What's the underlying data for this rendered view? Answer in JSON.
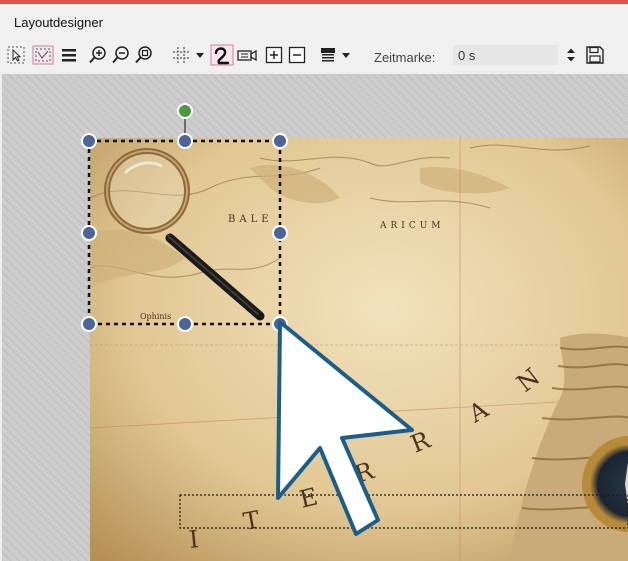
{
  "window": {
    "title": "Layoutdesigner"
  },
  "toolbar": {
    "icons": [
      "select-arrow-icon",
      "select-region-icon",
      "layers-icon",
      "zoom-in-icon",
      "zoom-out-icon",
      "zoom-fit-icon",
      "grid-icon",
      "dropdown-arrow-icon",
      "curve-path-icon",
      "camera-icon",
      "add-keyframe-icon",
      "remove-keyframe-icon",
      "text-style-icon",
      "dropdown-arrow-icon",
      "spinner-icon",
      "save-icon"
    ],
    "timestamp_label": "Zeitmarke:",
    "timestamp_value": "0 s"
  },
  "canvas": {
    "image_semantic": "antique-map-with-magnifier-and-compass",
    "map_words": [
      "BALE",
      "ARICUM",
      "E",
      "N",
      "A",
      "R",
      "R",
      "E",
      "T",
      "I",
      "Ophinis"
    ],
    "selection": {
      "handles": 8,
      "rotation_handle": true
    }
  },
  "colors": {
    "accent_red": "#d9534f",
    "handle_blue": "#4a6599",
    "rotate_green": "#4a9a3e",
    "guide_red": "#d35050",
    "cursor_fill": "#ffffff",
    "cursor_stroke": "#1d5d8a",
    "map_base": "#e8d3a6"
  }
}
